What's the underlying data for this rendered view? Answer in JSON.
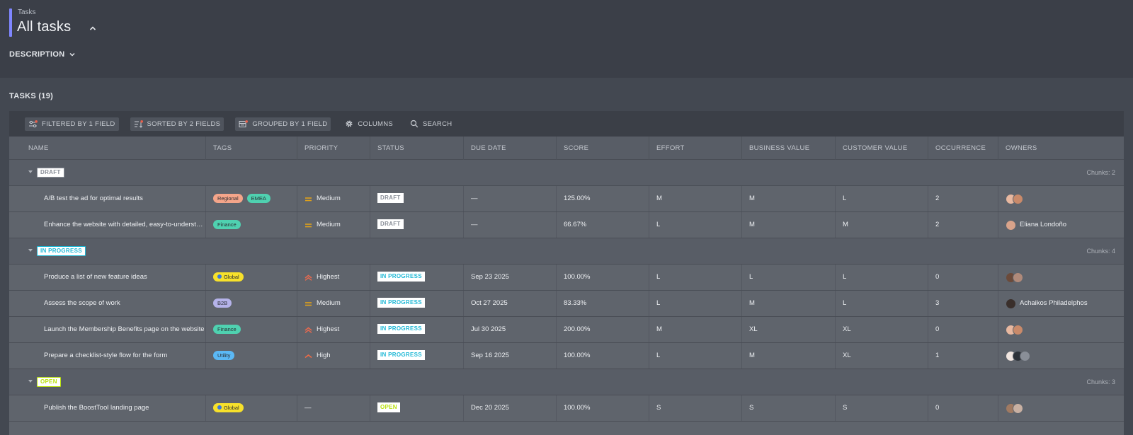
{
  "header": {
    "breadcrumb": "Tasks",
    "title": "All tasks",
    "description_label": "DESCRIPTION"
  },
  "section": {
    "title": "TASKS (19)"
  },
  "toolbar": {
    "filter_label": "FILTERED BY 1 FIELD",
    "sort_label": "SORTED BY 2 FIELDS",
    "group_label": "GROUPED BY 1 FIELD",
    "columns_label": "COLUMNS",
    "search_label": "SEARCH"
  },
  "columns": [
    "NAME",
    "TAGS",
    "PRIORITY",
    "STATUS",
    "DUE DATE",
    "SCORE",
    "EFFORT",
    "BUSINESS VALUE",
    "CUSTOMER VALUE",
    "OCCURRENCE",
    "OWNERS"
  ],
  "groups": [
    {
      "label": "DRAFT",
      "color": "#8a8f98",
      "chunks": "Chunks: 2",
      "rows": [
        {
          "name": "A/B test the ad for optimal results",
          "tags": [
            {
              "label": "Regional",
              "color": "#f4a58a"
            },
            {
              "label": "EMEA",
              "color": "#4fd1b0"
            }
          ],
          "priority": "Medium",
          "priority_icon": "medium-priority-icon",
          "status": "DRAFT",
          "due": "—",
          "score": "125.00%",
          "effort": "M",
          "business": "M",
          "customer": "L",
          "occurrence": "2",
          "owners": {
            "avatars": [
              "#e8b8a0",
              "#c98a6a"
            ],
            "name": ""
          }
        },
        {
          "name": "Enhance the website with detailed, easy-to-understa…",
          "tags": [
            {
              "label": "Finance",
              "color": "#4fd1b0"
            }
          ],
          "priority": "Medium",
          "priority_icon": "medium-priority-icon",
          "status": "DRAFT",
          "due": "—",
          "score": "66.67%",
          "effort": "L",
          "business": "M",
          "customer": "M",
          "occurrence": "2",
          "owners": {
            "avatars": [
              "#d9a38a"
            ],
            "name": "Eliana Londoño"
          }
        }
      ]
    },
    {
      "label": "IN PROGRESS",
      "color": "#1fb8d6",
      "chunks": "Chunks: 4",
      "rows": [
        {
          "name": "Produce a list of new feature ideas",
          "tags": [
            {
              "label": "Global",
              "color": "#f7e12b",
              "dot": true
            }
          ],
          "priority": "Highest",
          "priority_icon": "highest-priority-icon",
          "status": "IN PROGRESS",
          "due": "Sep 23 2025",
          "score": "100.00%",
          "effort": "L",
          "business": "L",
          "customer": "L",
          "occurrence": "0",
          "owners": {
            "avatars": [
              "#6b4a3a",
              "#b08a7a"
            ],
            "name": ""
          }
        },
        {
          "name": "Assess the scope of work",
          "tags": [
            {
              "label": "B2B",
              "color": "#b5b3ea"
            }
          ],
          "priority": "Medium",
          "priority_icon": "medium-priority-icon",
          "status": "IN PROGRESS",
          "due": "Oct 27 2025",
          "score": "83.33%",
          "effort": "L",
          "business": "M",
          "customer": "L",
          "occurrence": "3",
          "owners": {
            "avatars": [
              "#3a2f2b"
            ],
            "name": "Achaikos Philadelphos"
          }
        },
        {
          "name": "Launch the Membership Benefits page on the website",
          "tags": [
            {
              "label": "Finance",
              "color": "#4fd1b0"
            }
          ],
          "priority": "Highest",
          "priority_icon": "highest-priority-icon",
          "status": "IN PROGRESS",
          "due": "Jul 30 2025",
          "score": "200.00%",
          "effort": "M",
          "business": "XL",
          "customer": "XL",
          "occurrence": "0",
          "owners": {
            "avatars": [
              "#e8b8a0",
              "#c98a6a"
            ],
            "name": ""
          }
        },
        {
          "name": "Prepare a checklist-style flow for the form",
          "tags": [
            {
              "label": "Utility",
              "color": "#5bb8f5"
            }
          ],
          "priority": "High",
          "priority_icon": "high-priority-icon",
          "status": "IN PROGRESS",
          "due": "Sep 16 2025",
          "score": "100.00%",
          "effort": "L",
          "business": "M",
          "customer": "XL",
          "occurrence": "1",
          "owners": {
            "avatars": [
              "#f1e6e0",
              "#2e3238",
              "#8a8f98"
            ],
            "name": ""
          }
        }
      ]
    },
    {
      "label": "OPEN",
      "color": "#b9e10c",
      "chunks": "Chunks: 3",
      "rows": [
        {
          "name": "Publish the BoostTool landing page",
          "tags": [
            {
              "label": "Global",
              "color": "#f7e12b",
              "dot": true
            }
          ],
          "priority": "—",
          "priority_icon": "",
          "status": "OPEN",
          "due": "Dec 20 2025",
          "score": "100.00%",
          "effort": "S",
          "business": "S",
          "customer": "S",
          "occurrence": "0",
          "owners": {
            "avatars": [
              "#a07a62",
              "#c8b0a2"
            ],
            "name": ""
          }
        }
      ]
    }
  ],
  "colors": {
    "accent": "#7f86ff",
    "priority_medium": "#e0a21a",
    "priority_highest": "#e86a4f",
    "priority_high": "#f06b45"
  }
}
